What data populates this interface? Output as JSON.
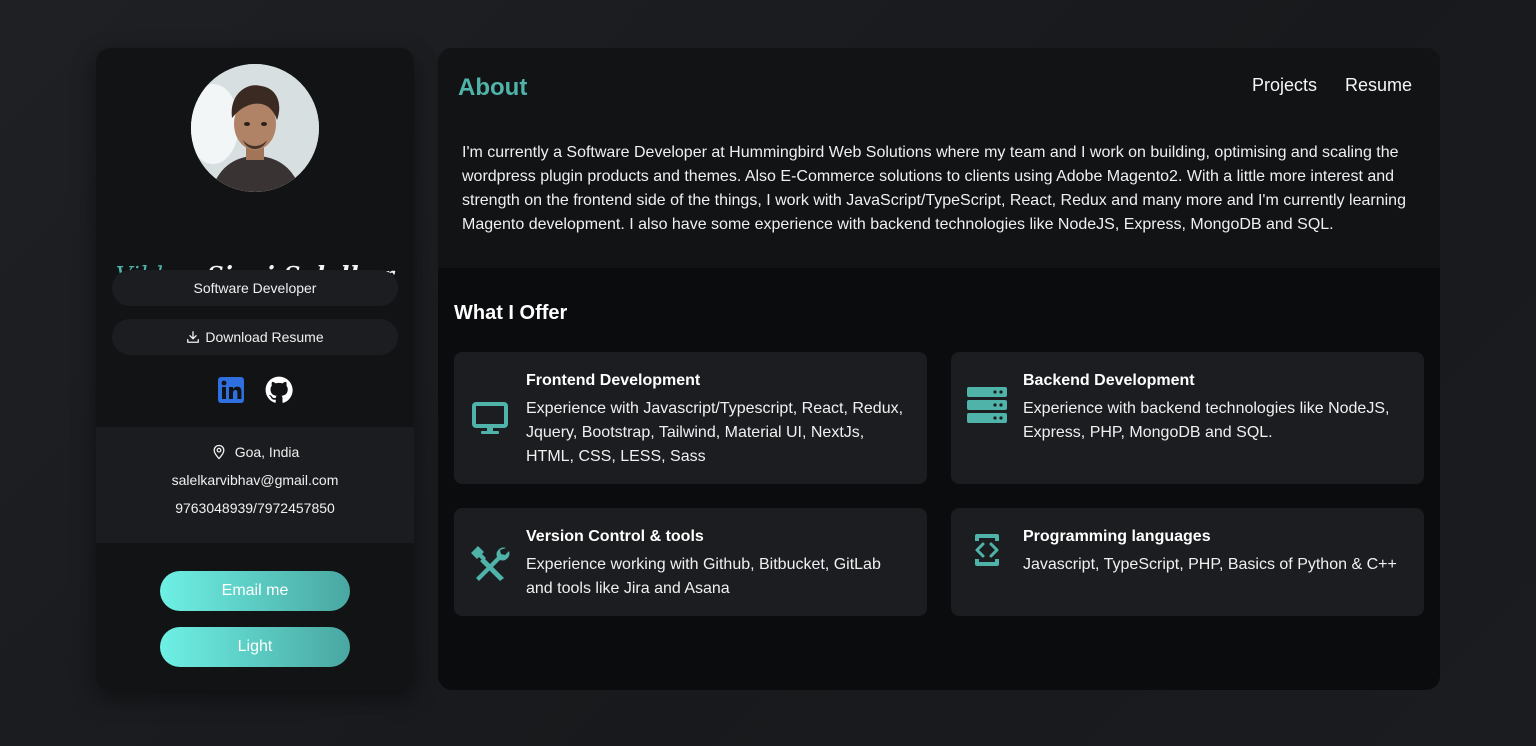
{
  "profile": {
    "name_first": "Vibhav",
    "name_rest": "Sinai Salelkar",
    "role": "Software Developer",
    "download_label": "Download Resume",
    "location": "Goa, India",
    "email": "salelkarvibhav@gmail.com",
    "phone": "9763048939/7972457850",
    "email_button": "Email me",
    "theme_button": "Light",
    "social_icons": [
      "linkedin-icon",
      "github-icon"
    ]
  },
  "about": {
    "title": "About",
    "nav": [
      "Projects",
      "Resume"
    ],
    "text": "I'm currently a Software Developer at Hummingbird Web Solutions where my team and I work on building, optimising and scaling the wordpress plugin products and themes. Also E-Commerce solutions to clients using Adobe Magento2. With a little more interest and strength on the frontend side of the things, I work with JavaScript/TypeScript, React, Redux and many more and I'm currently learning Magento development. I also have some experience with backend technologies like NodeJS, Express, MongoDB and SQL."
  },
  "offer": {
    "title": "What I Offer",
    "cards": [
      {
        "title": "Frontend Development",
        "desc": "Experience with Javascript/Typescript, React, Redux, Jquery, Bootstrap, Tailwind, Material UI, NextJs, HTML, CSS, LESS, Sass",
        "icon": "monitor-icon"
      },
      {
        "title": "Backend Development",
        "desc": "Experience with backend technologies like NodeJS, Express, PHP, MongoDB and SQL.",
        "icon": "server-icon"
      },
      {
        "title": "Version Control & tools",
        "desc": "Experience working with Github, Bitbucket, GitLab and tools like Jira and Asana",
        "icon": "tools-icon"
      },
      {
        "title": "Programming languages",
        "desc": "Javascript, TypeScript, PHP, Basics of Python & C++",
        "icon": "code-icon"
      }
    ]
  },
  "colors": {
    "accent": "#4fb3a9",
    "button_gradient_start": "#6ef0e4",
    "button_gradient_end": "#49a7a1",
    "linkedin": "#2f6fe0"
  }
}
